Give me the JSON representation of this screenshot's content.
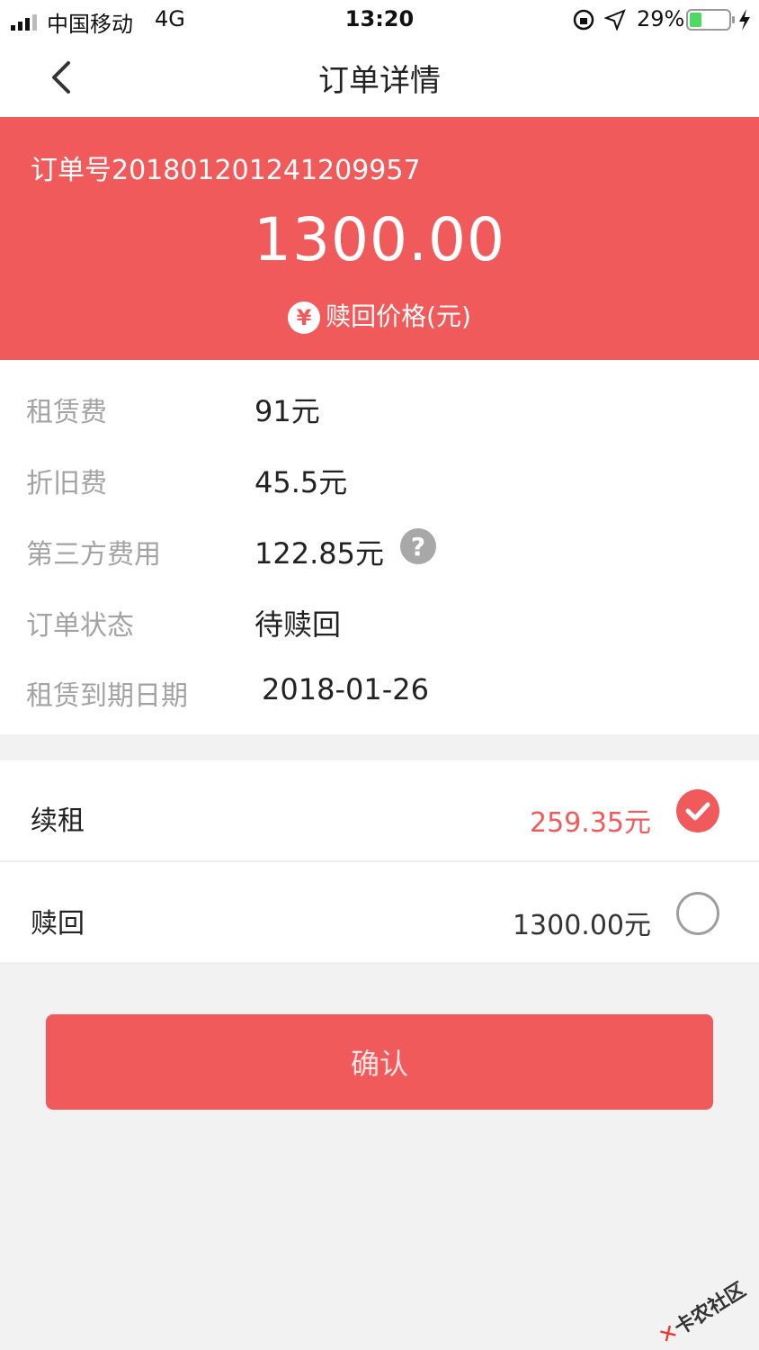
{
  "status_bar": {
    "carrier": "中国移动",
    "network": "4G",
    "time": "13:20",
    "battery": "29%"
  },
  "nav": {
    "title": "订单详情",
    "back_icon": "chevron-left-icon"
  },
  "summary": {
    "order_number": "订单号201801201241209957",
    "amount": "1300.00",
    "price_label": "赎回价格(元)",
    "currency_symbol": "¥"
  },
  "details": [
    {
      "label": "租赁费",
      "value": "91元"
    },
    {
      "label": "折旧费",
      "value": "45.5元"
    },
    {
      "label": "第三方费用",
      "value": "122.85元"
    },
    {
      "label": "订单状态",
      "value": "待赎回"
    },
    {
      "label": "租赁到期日期",
      "value": "2018-01-26"
    }
  ],
  "help_icon_glyph": "?",
  "options": [
    {
      "label": "续租",
      "price": "259.35元",
      "selected": true
    },
    {
      "label": "赎回",
      "price": "1300.00元",
      "selected": false
    }
  ],
  "confirm_label": "确认",
  "watermark": "卡农社区",
  "colors": {
    "accent": "#f05a5a",
    "label_gray": "#a3a3a3"
  }
}
